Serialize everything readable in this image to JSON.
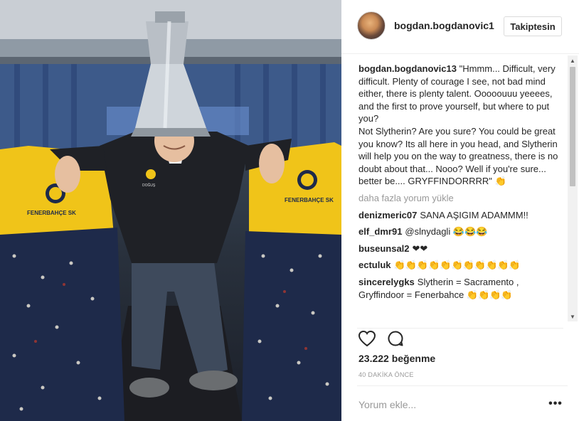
{
  "post": {
    "username": "bogdan.bogdanovic1",
    "follow_label": "Takiptesin",
    "caption_user": "bogdan.bogdanovic13",
    "caption_text": "\"Hmmm... Difficult, very difficult. Plenty of courage I see, not bad mind either, there is plenty talent. Ooooouuu yeeees, and the first to prove yourself, but where to put you?\nNot Slytherin? Are you sure? You could be great you know? Its all here in you head, and Slytherin will help you on the way to greatness, there is no doubt about that... Nooo? Well if you're sure... better be.... GRYFFINDORRRR\" 👏",
    "load_more": "daha fazla yorum yükle",
    "comments": [
      {
        "user": "denizmeric07",
        "text": "SANA AŞIGIM ADAMMM!!"
      },
      {
        "user": "elf_dmr91",
        "text": "@slnydagli 😂😂😂"
      },
      {
        "user": "buseunsal2",
        "text": "❤❤"
      },
      {
        "user": "ectuluk",
        "text": "👏👏👏👏👏👏👏👏👏👏👏"
      },
      {
        "user": "sincerelygks",
        "text": "Slytherin = Sacramento , Gryffindoor = Fenerbahce 👏👏👏👏"
      }
    ],
    "likes": "23.222 beğenme",
    "time": "40 DAKİKA ÖNCE",
    "comment_placeholder": "Yorum ekle...",
    "more_label": "•••"
  },
  "photo": {
    "seat_brand": "FENERBAHÇE SK",
    "jacket_logo": "DOĞUŞ"
  },
  "icons": {
    "like": "heart-icon",
    "comment": "comment-bubble-icon",
    "more": "more-options-icon"
  },
  "colors": {
    "seat_yellow": "#f0c419",
    "seat_navy": "#1e2a4a",
    "panel_border": "#efefef",
    "muted_text": "#999999"
  }
}
